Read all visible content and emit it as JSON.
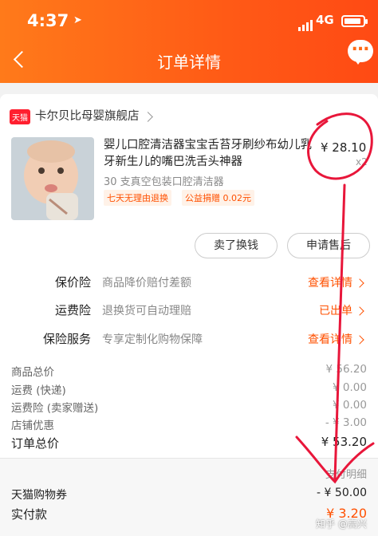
{
  "status_bar": {
    "time": "4:37",
    "network": "4G"
  },
  "nav": {
    "title": "订单详情",
    "more_label": "…"
  },
  "colors": {
    "accent": "#ff5000",
    "header_start": "#ff7a1a",
    "header_end": "#ff4a14",
    "annotation": "#e8163a"
  },
  "shop": {
    "badge": "天猫",
    "name": "卡尔贝比母婴旗舰店"
  },
  "product": {
    "title": "婴儿口腔清洁器宝宝舌苔牙刷纱布幼儿乳牙新生儿的嘴巴洗舌头神器",
    "price": "¥ 28.10",
    "quantity": "x2",
    "spec": "30 支真空包装口腔清洁器",
    "tags": [
      "七天无理由退换",
      "公益捐赠 0.02元"
    ]
  },
  "actions": {
    "exchange": "卖了换钱",
    "after_sale": "申请售后"
  },
  "services": [
    {
      "label": "保价险",
      "desc": "商品降价赔付差额",
      "link": "查看详情"
    },
    {
      "label": "运费险",
      "desc": "退换货可自动理赔",
      "link": "已出单"
    },
    {
      "label": "保险服务",
      "desc": "专享定制化购物保障",
      "link": "查看详情"
    }
  ],
  "summary": [
    {
      "label": "商品总价",
      "value": "¥ 56.20"
    },
    {
      "label": "运费 (快递)",
      "value": "¥ 0.00"
    },
    {
      "label": "运费险 (卖家赠送)",
      "value": "¥ 0.00"
    },
    {
      "label": "店铺优惠",
      "value": "- ¥ 3.00"
    }
  ],
  "order_total": {
    "label": "订单总价",
    "value": "¥ 53.20"
  },
  "payment": {
    "detail_link": "支付明细",
    "coupon_label": "天猫购物券",
    "coupon_value": "- ¥ 50.00",
    "paid_label": "实付款",
    "paid_value": "¥ 3.20"
  },
  "watermark": "知乎 @高兴"
}
